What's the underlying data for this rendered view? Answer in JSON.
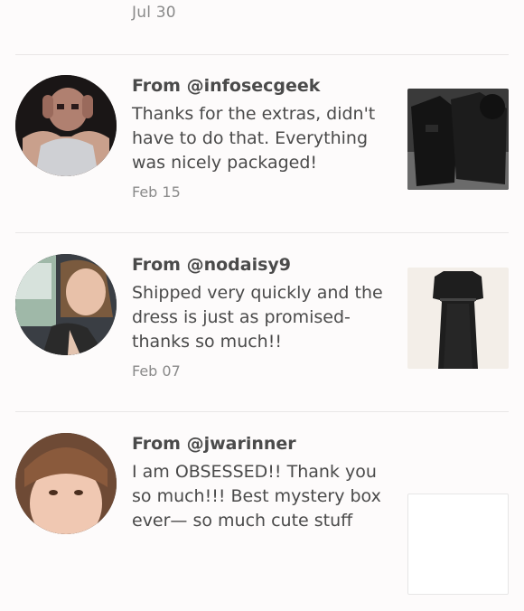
{
  "top_item": {
    "date": "Jul 30"
  },
  "reviews": [
    {
      "from": "From @infosecgeek",
      "text": "Thanks for the extras, didn't have to do that. Everything was nicely packaged!",
      "date": "Feb 15"
    },
    {
      "from": "From @nodaisy9",
      "text": "Shipped very quickly and the dress is just as promised- thanks so much!!",
      "date": "Feb 07"
    },
    {
      "from": "From @jwarinner",
      "text": "I am OBSESSED!! Thank you so much!!! Best mystery box ever— so much cute stuff",
      "date": ""
    }
  ],
  "colors": {
    "background": "#fdfbfb",
    "text": "#4a4a4a",
    "muted": "#8a8a8a",
    "divider": "#e9e6e6"
  }
}
